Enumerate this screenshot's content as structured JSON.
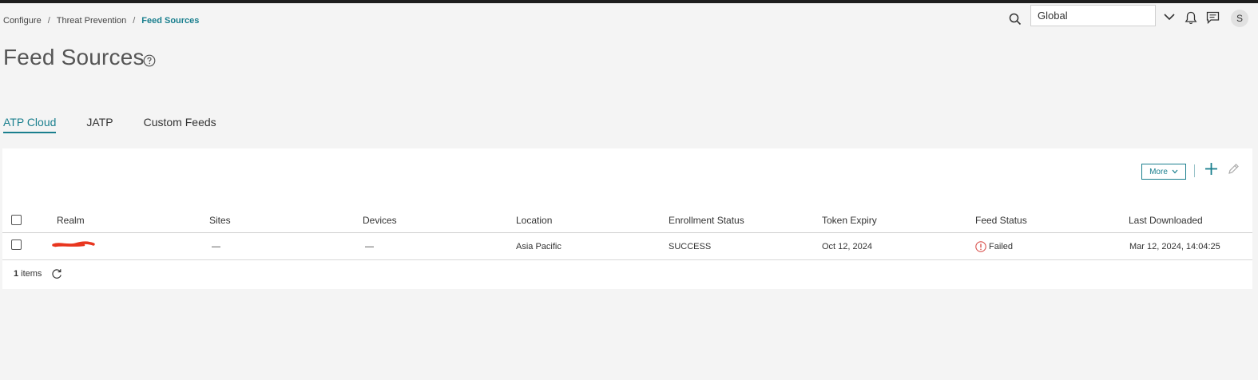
{
  "breadcrumb": {
    "items": [
      "Configure",
      "Threat Prevention"
    ],
    "current": "Feed Sources"
  },
  "header": {
    "scope_value": "Global",
    "avatar_initial": "S"
  },
  "page": {
    "title": "Feed Sources"
  },
  "tabs": [
    {
      "label": "ATP Cloud",
      "active": true
    },
    {
      "label": "JATP",
      "active": false
    },
    {
      "label": "Custom Feeds",
      "active": false
    }
  ],
  "toolbar": {
    "more_label": "More"
  },
  "table": {
    "columns": [
      "Realm",
      "Sites",
      "Devices",
      "Location",
      "Enrollment Status",
      "Token Expiry",
      "Feed Status",
      "Last Downloaded"
    ],
    "rows": [
      {
        "realm": "",
        "sites": "—",
        "devices": "—",
        "location": "Asia Pacific",
        "enrollment_status": "SUCCESS",
        "token_expiry": "Oct 12, 2024",
        "feed_status": "Failed",
        "last_downloaded": "Mar 12, 2024, 14:04:25"
      }
    ]
  },
  "footer": {
    "count": "1",
    "count_suffix": "items"
  },
  "colors": {
    "accent": "#1a7f8e",
    "error": "#d9534f",
    "redaction": "#e8361f"
  }
}
